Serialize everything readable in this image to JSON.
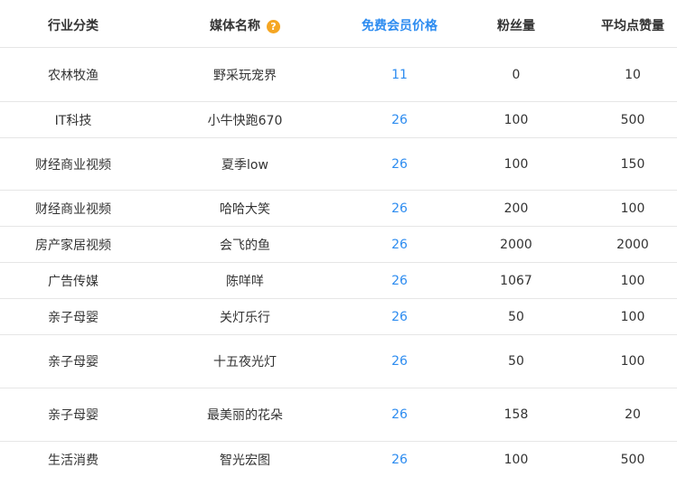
{
  "header": {
    "industry": "行业分类",
    "media_name": "媒体名称",
    "help_icon_glyph": "?",
    "price": "免费会员价格",
    "fans": "粉丝量",
    "likes": "平均点赞量"
  },
  "colors": {
    "accent": "#2d8cf0",
    "help_icon": "#f5a623",
    "text": "#333333",
    "divider": "#e6e6e6"
  },
  "rows": [
    {
      "industry": "农林牧渔",
      "media": "野采玩宠界",
      "price": "11",
      "fans": "0",
      "likes": "10"
    },
    {
      "industry": "IT科技",
      "media": "小牛快跑670",
      "price": "26",
      "fans": "100",
      "likes": "500"
    },
    {
      "industry": "财经商业视频",
      "media": "夏季low",
      "price": "26",
      "fans": "100",
      "likes": "150"
    },
    {
      "industry": "财经商业视频",
      "media": "哈哈大笑",
      "price": "26",
      "fans": "200",
      "likes": "100"
    },
    {
      "industry": "房产家居视频",
      "media": "会飞的鱼",
      "price": "26",
      "fans": "2000",
      "likes": "2000"
    },
    {
      "industry": "广告传媒",
      "media": "陈咩咩",
      "price": "26",
      "fans": "1067",
      "likes": "100"
    },
    {
      "industry": "亲子母婴",
      "media": "关灯乐行",
      "price": "26",
      "fans": "50",
      "likes": "100"
    },
    {
      "industry": "亲子母婴",
      "media": "十五夜光灯",
      "price": "26",
      "fans": "50",
      "likes": "100"
    },
    {
      "industry": "亲子母婴",
      "media": "最美丽的花朵",
      "price": "26",
      "fans": "158",
      "likes": "20"
    },
    {
      "industry": "生活消费",
      "media": "智光宏图",
      "price": "26",
      "fans": "100",
      "likes": "500"
    }
  ]
}
